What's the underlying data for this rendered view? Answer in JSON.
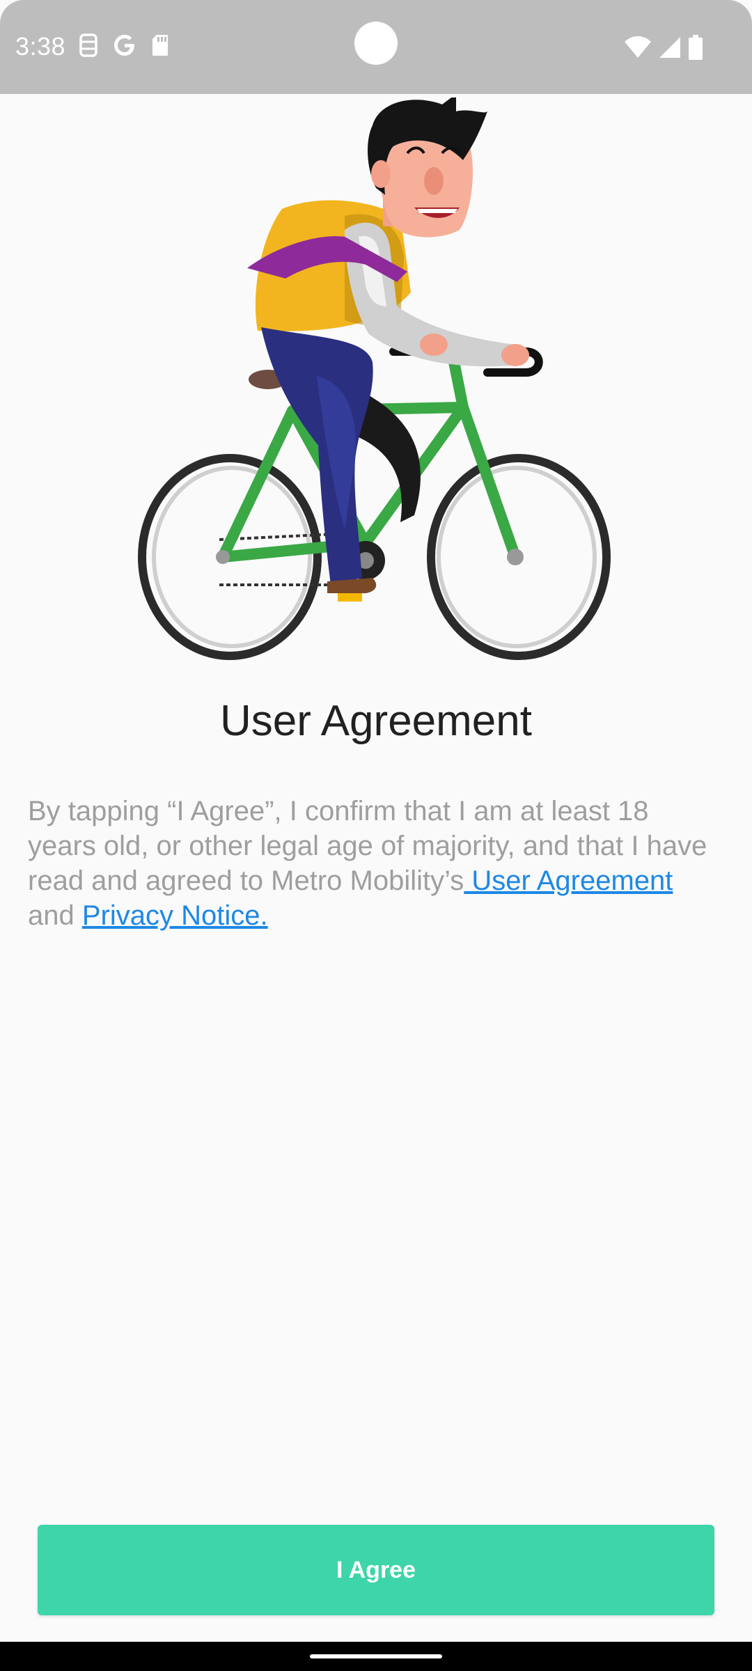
{
  "status_bar": {
    "time": "3:38",
    "icons_left": [
      "sim-toolkit-icon",
      "google-icon",
      "sd-card-icon"
    ],
    "icons_right": [
      "wifi-icon",
      "cellular-signal-icon",
      "battery-icon"
    ]
  },
  "hero": {
    "illustration": "man-riding-bicycle-illustration"
  },
  "agreement": {
    "title": "User Agreement",
    "text_before": "By tapping “I Agree”, I confirm that I am at least 18 years old, or other legal age of majority, and that I have read and agreed to Metro Mobility’s",
    "user_agreement_link": " User Agreement",
    "text_middle": " and ",
    "privacy_link": "Privacy Notice."
  },
  "actions": {
    "agree_label": "I Agree"
  },
  "colors": {
    "accent": "#3dd5a9",
    "link": "#1e88e5",
    "status_bar": "#bdbdbd",
    "body_text": "#9e9e9e",
    "title_text": "#212121"
  }
}
